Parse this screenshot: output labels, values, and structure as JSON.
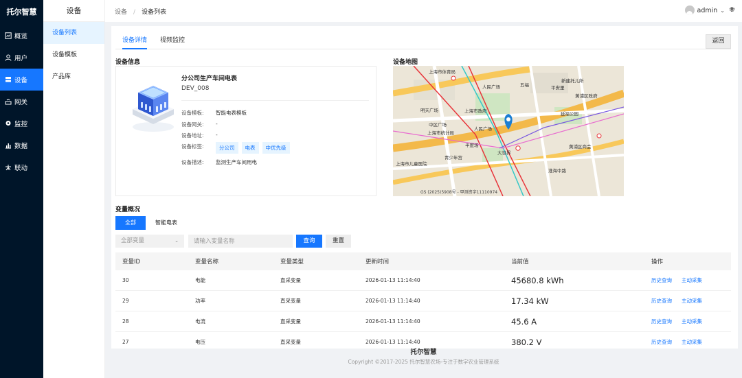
{
  "brand": "托尔智慧",
  "nav": [
    {
      "label": "概览",
      "icon": "dashboard-icon"
    },
    {
      "label": "用户",
      "icon": "user-icon"
    },
    {
      "label": "设备",
      "icon": "device-icon"
    },
    {
      "label": "网关",
      "icon": "gateway-icon"
    },
    {
      "label": "监控",
      "icon": "monitor-icon"
    },
    {
      "label": "数据",
      "icon": "chart-icon"
    },
    {
      "label": "联动",
      "icon": "linkage-icon"
    }
  ],
  "sub_sidebar": {
    "title": "设备",
    "items": [
      {
        "label": "设备列表"
      },
      {
        "label": "设备模板"
      },
      {
        "label": "产品库"
      }
    ]
  },
  "breadcrumb": {
    "root": "设备",
    "sep": "/",
    "current": "设备列表"
  },
  "user": {
    "name": "admin"
  },
  "tabs": [
    {
      "label": "设备详情"
    },
    {
      "label": "视频监控"
    }
  ],
  "back_label": "返回",
  "device_info": {
    "section_title": "设备信息",
    "name": "分公司生产车间电表",
    "code": "DEV_008",
    "fields": {
      "template_label": "设备模板:",
      "template_value": "智能电表模板",
      "gateway_label": "设备网关:",
      "gateway_value": "-",
      "address_label": "设备地址:",
      "address_value": "-",
      "tags_label": "设备标签:",
      "desc_label": "设备描述:",
      "desc_value": "监测生产车间用电"
    },
    "tags": [
      "分公司",
      "电表",
      "中优先级"
    ]
  },
  "map": {
    "section_title": "设备地图",
    "labels": [
      "上海市体育局",
      "人民广场",
      "新建托儿所",
      "黄浦区政府",
      "明天广场",
      "上海市政府",
      "中区广场",
      "人民广场",
      "延福公园",
      "大世界",
      "黄浦区商会",
      "青少年宫",
      "五福",
      "上海市统计局",
      "平安里",
      "半度场",
      "上海市儿童医院",
      "淮海中路"
    ],
    "copyright": "GS (2025)5908号 - 甲测资字11110974"
  },
  "variables": {
    "section_title": "变量概况",
    "filter_tabs": [
      "全部",
      "智能电表"
    ],
    "select_value": "全部变量",
    "search_placeholder": "请输入变量名称",
    "query_label": "查询",
    "reset_label": "重置",
    "columns": [
      "变量ID",
      "变量名称",
      "变量类型",
      "更新时间",
      "当前值",
      "操作"
    ],
    "rows": [
      {
        "id": "30",
        "name": "电能",
        "type": "直采变量",
        "time": "2026-01-13 11:14:40",
        "value": "45680.8 kWh"
      },
      {
        "id": "29",
        "name": "功率",
        "type": "直采变量",
        "time": "2026-01-13 11:14:40",
        "value": "17.34 kW"
      },
      {
        "id": "28",
        "name": "电流",
        "type": "直采变量",
        "time": "2026-01-13 11:14:40",
        "value": "45.6 A"
      },
      {
        "id": "27",
        "name": "电压",
        "type": "直采变量",
        "time": "2026-01-13 11:14:40",
        "value": "380.2 V"
      }
    ],
    "op_history": "历史查询",
    "op_collect": "主动采集"
  },
  "footer": {
    "title": "托尔智慧",
    "copyright": "Copyright ©2017-2025 托尔智慧农场-专注于数字农业管理系统"
  },
  "colors": {
    "primary": "#1677ff",
    "nav_bg": "#001529"
  }
}
